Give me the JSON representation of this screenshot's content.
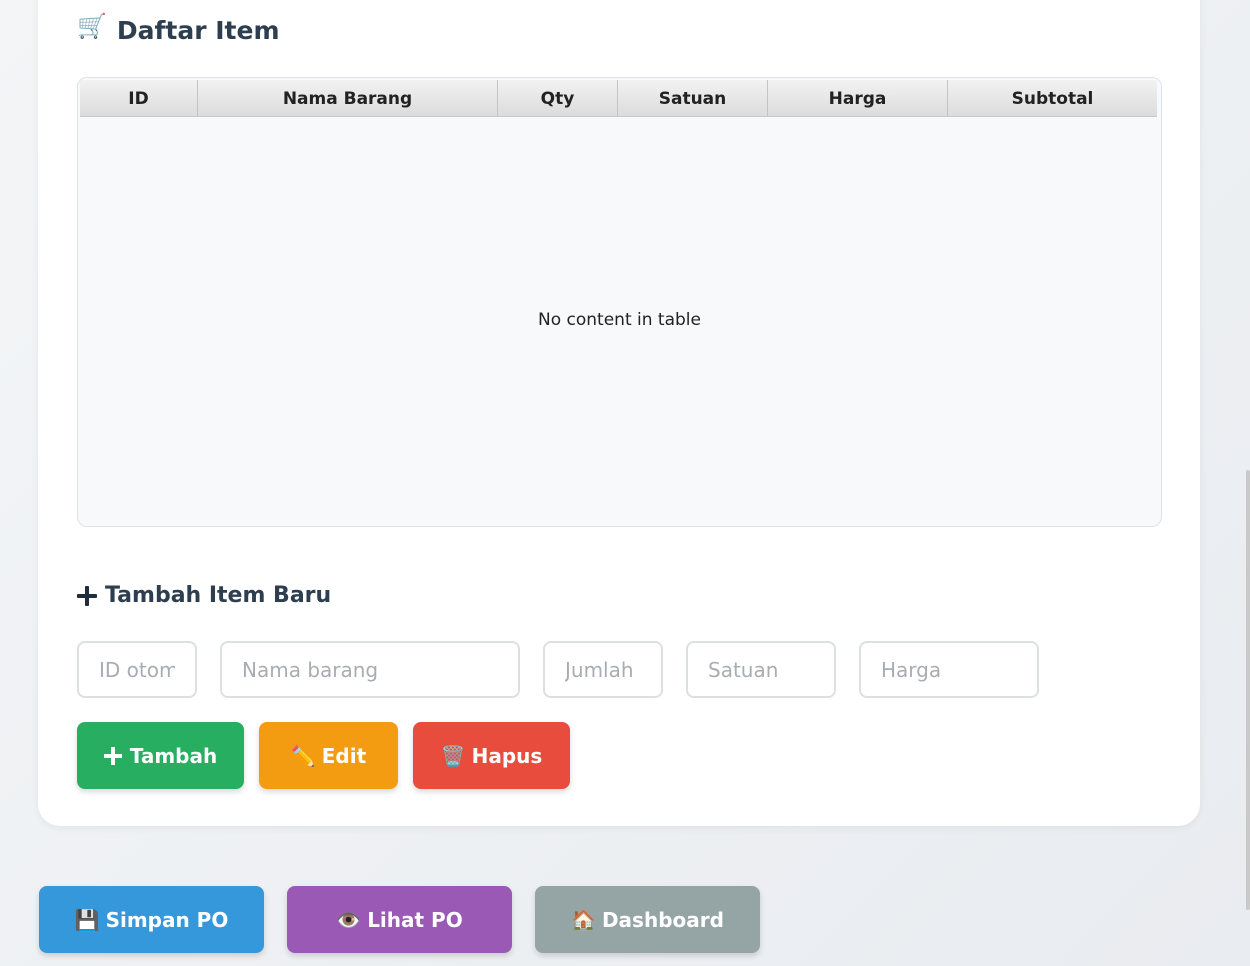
{
  "items_section": {
    "title": "Daftar Item",
    "icon": "cart-icon",
    "icon_glyph": "🛒"
  },
  "table": {
    "columns": [
      "ID",
      "Nama Barang",
      "Qty",
      "Satuan",
      "Harga",
      "Subtotal"
    ],
    "empty_message": "No content in table"
  },
  "new_item_section": {
    "title": "Tambah Item Baru"
  },
  "inputs": {
    "id_placeholder": "ID otomatis",
    "name_placeholder": "Nama barang",
    "qty_placeholder": "Jumlah",
    "unit_placeholder": "Satuan",
    "price_placeholder": "Harga"
  },
  "item_buttons": {
    "add_label": "Tambah",
    "edit_icon": "✏️",
    "edit_label": "Edit",
    "delete_icon": "🗑️",
    "delete_label": "Hapus"
  },
  "footer_buttons": {
    "save_icon": "💾",
    "save_label": "Simpan PO",
    "view_icon": "👁️",
    "view_label": "Lihat PO",
    "dashboard_icon": "🏠",
    "dashboard_label": "Dashboard"
  },
  "colors": {
    "add": "#27ae60",
    "edit": "#f39c12",
    "delete": "#e74c3c",
    "save": "#3498db",
    "view": "#9b59b6",
    "dashboard": "#95a5a6"
  }
}
